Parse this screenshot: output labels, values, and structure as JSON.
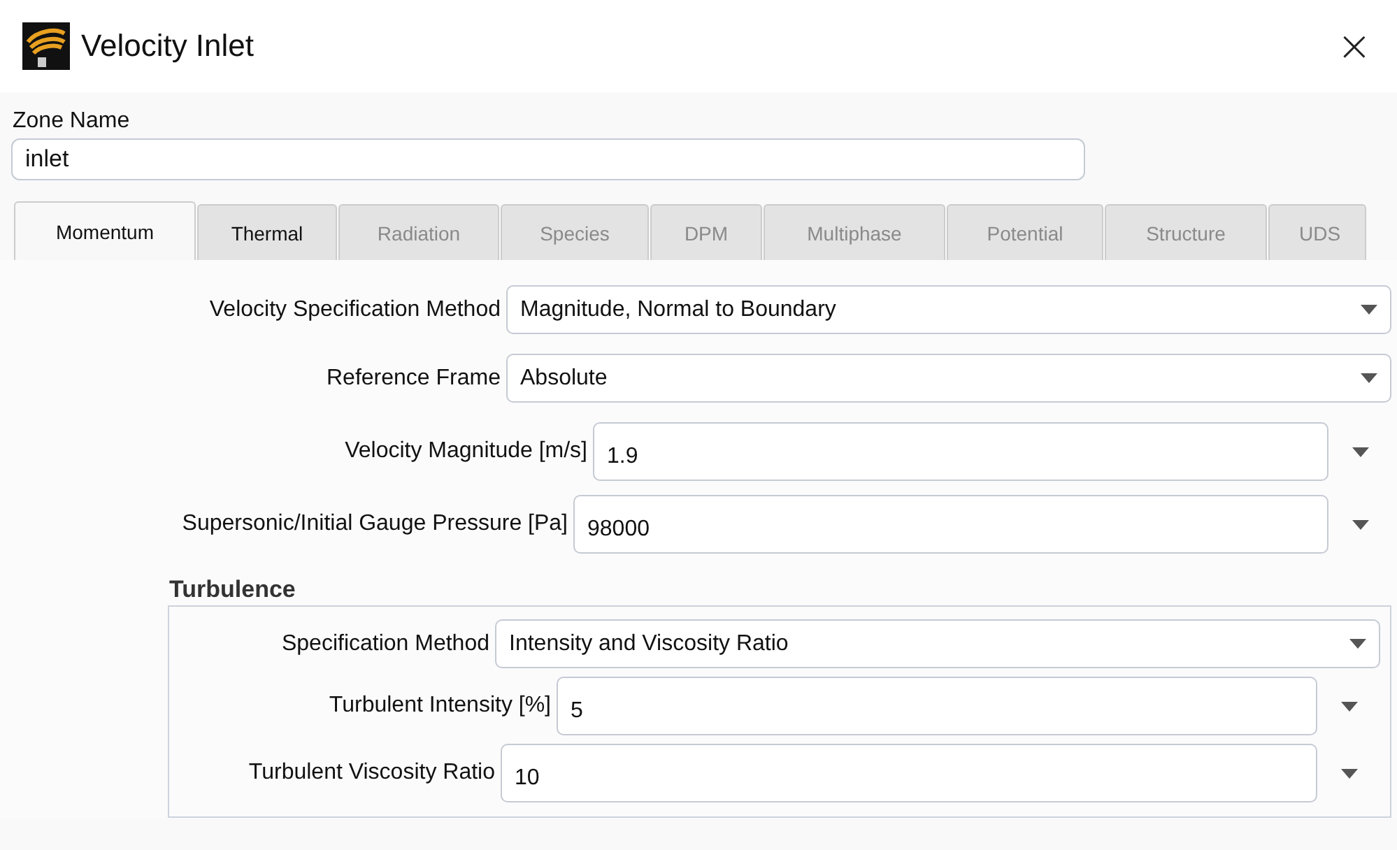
{
  "window": {
    "title": "Velocity Inlet",
    "close": "×"
  },
  "zone_name": {
    "label": "Zone Name",
    "value": "inlet"
  },
  "tabs": [
    {
      "label": "Momentum",
      "selected": true,
      "disabled": false
    },
    {
      "label": "Thermal",
      "selected": false,
      "disabled": false
    },
    {
      "label": "Radiation",
      "selected": false,
      "disabled": true
    },
    {
      "label": "Species",
      "selected": false,
      "disabled": true
    },
    {
      "label": "DPM",
      "selected": false,
      "disabled": true
    },
    {
      "label": "Multiphase",
      "selected": false,
      "disabled": true
    },
    {
      "label": "Potential",
      "selected": false,
      "disabled": true
    },
    {
      "label": "Structure",
      "selected": false,
      "disabled": true
    },
    {
      "label": "UDS",
      "selected": false,
      "disabled": true
    }
  ],
  "fields": [
    {
      "label": "Velocity Specification Method",
      "kind": "dropdown",
      "value": "Magnitude, Normal to Boundary"
    },
    {
      "label": "Reference Frame",
      "kind": "dropdown",
      "value": "Absolute"
    },
    {
      "label": "Velocity Magnitude [m/s]",
      "kind": "number",
      "value": "1.9"
    },
    {
      "label": "Supersonic/Initial Gauge Pressure [Pa]",
      "kind": "number",
      "value": "98000"
    }
  ],
  "turbulence": {
    "title": "Turbulence",
    "fields": [
      {
        "label": "Specification Method",
        "kind": "dropdown",
        "value": "Intensity and Viscosity Ratio"
      },
      {
        "label": "Turbulent Intensity [%]",
        "kind": "number",
        "value": "5"
      },
      {
        "label": "Turbulent Viscosity Ratio",
        "kind": "number",
        "value": "10"
      }
    ]
  }
}
